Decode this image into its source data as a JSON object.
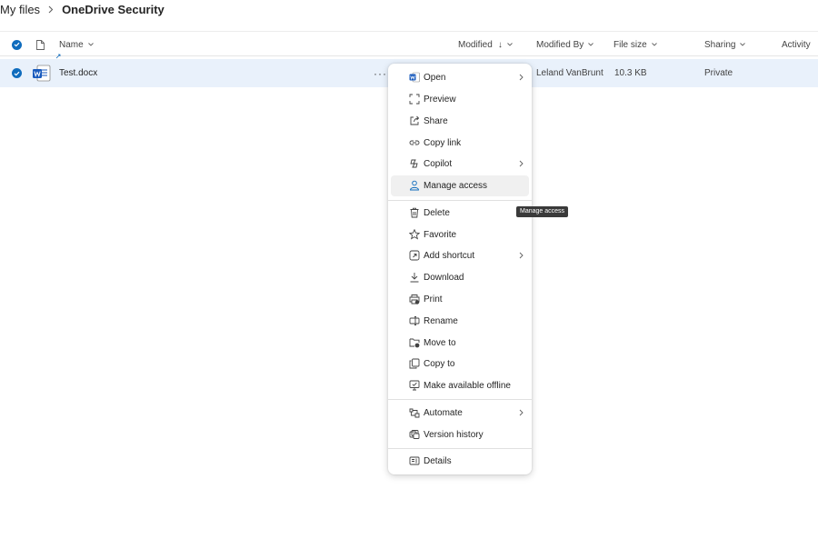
{
  "breadcrumb": {
    "root": "My files",
    "current": "OneDrive Security"
  },
  "columns": {
    "name": "Name",
    "modified": "Modified",
    "modified_sort_glyph": "↓",
    "modified_by": "Modified By",
    "file_size": "File size",
    "sharing": "Sharing",
    "activity": "Activity"
  },
  "file": {
    "name": "Test.docx",
    "more_glyph": "···",
    "modified_by": "Leland VanBrunt",
    "file_size": "10.3 KB",
    "sharing": "Private",
    "icon": "word-document-icon",
    "selected": true
  },
  "context_menu": {
    "items": [
      {
        "label": "Open",
        "icon": "word-icon",
        "submenu": true
      },
      {
        "label": "Preview",
        "icon": "preview-icon"
      },
      {
        "label": "Share",
        "icon": "share-icon"
      },
      {
        "label": "Copy link",
        "icon": "link-icon"
      },
      {
        "label": "Copilot",
        "icon": "copilot-icon",
        "submenu": true
      },
      {
        "label": "Manage access",
        "icon": "person-icon",
        "hovered": true
      },
      {
        "label": "Delete",
        "icon": "trash-icon"
      },
      {
        "label": "Favorite",
        "icon": "star-icon"
      },
      {
        "label": "Add shortcut",
        "icon": "shortcut-icon",
        "submenu": true
      },
      {
        "label": "Download",
        "icon": "download-icon"
      },
      {
        "label": "Print",
        "icon": "print-icon"
      },
      {
        "label": "Rename",
        "icon": "rename-icon"
      },
      {
        "label": "Move to",
        "icon": "move-icon"
      },
      {
        "label": "Copy to",
        "icon": "copy-icon"
      },
      {
        "label": "Make available offline",
        "icon": "offline-icon"
      },
      {
        "label": "Automate",
        "icon": "automate-icon",
        "submenu": true
      },
      {
        "label": "Version history",
        "icon": "history-icon"
      },
      {
        "label": "Details",
        "icon": "details-icon"
      }
    ]
  },
  "tooltip": {
    "text": "Manage access"
  },
  "colors": {
    "accent": "#0f6cbd",
    "selected_row": "#e9f1fb",
    "word_blue": "#185abd",
    "menu_hover": "#f0f0f0",
    "tooltip_bg": "#3a3a3a"
  }
}
